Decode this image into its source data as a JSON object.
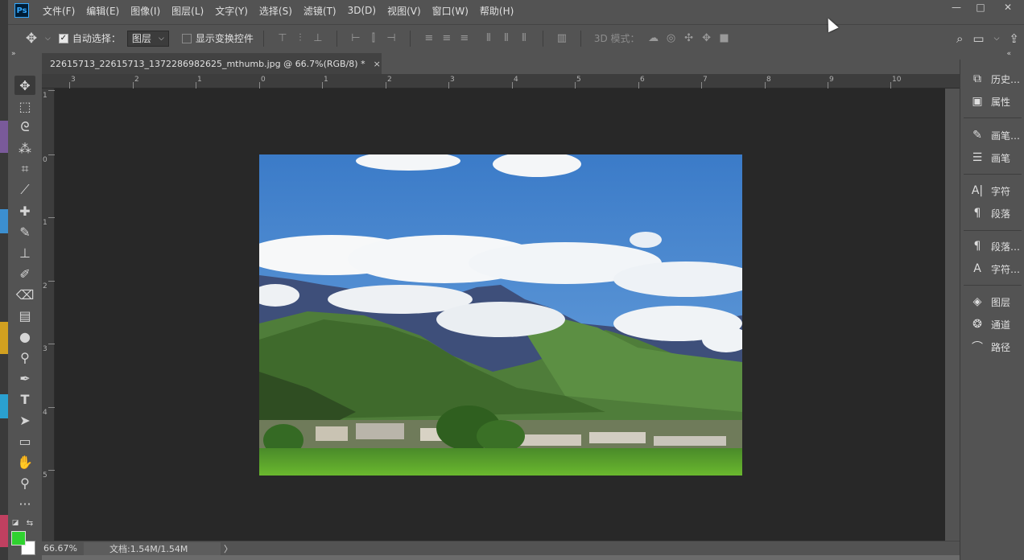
{
  "menubar": {
    "app_logo": "Ps",
    "items": [
      "文件(F)",
      "编辑(E)",
      "图像(I)",
      "图层(L)",
      "文字(Y)",
      "选择(S)",
      "滤镜(T)",
      "3D(D)",
      "视图(V)",
      "窗口(W)",
      "帮助(H)"
    ],
    "window_controls": [
      "—",
      "□",
      "✕"
    ]
  },
  "options": {
    "auto_select_label": "自动选择：",
    "auto_select_checked": true,
    "layer_select_value": "图层",
    "show_transform_label": "显示变换控件",
    "show_transform_checked": false,
    "mode_3d_label": "3D 模式："
  },
  "document": {
    "tab_title": "22615713_22615713_1372286982625_mthumb.jpg @ 66.7%(RGB/8) *",
    "close_glyph": "×"
  },
  "rulers": {
    "top_ticks": [
      "3",
      "2",
      "1",
      "0",
      "1",
      "2",
      "3",
      "4",
      "5",
      "6",
      "7",
      "8",
      "9",
      "10"
    ],
    "left_ticks": [
      "1",
      "0",
      "1",
      "2",
      "3",
      "4",
      "5"
    ]
  },
  "status": {
    "zoom": "66.67%",
    "doc_info": "文档:1.54M/1.54M",
    "arrow": "〉"
  },
  "panels": {
    "groups": [
      [
        "历史…",
        "属性"
      ],
      [
        "画笔…",
        "画笔"
      ],
      [
        "字符",
        "段落"
      ],
      [
        "段落…",
        "字符…"
      ],
      [
        "图层",
        "通道",
        "路径"
      ]
    ]
  },
  "colors": {
    "foreground": "#2fd22f",
    "background": "#ffffff",
    "ui_panel": "#535353",
    "canvas_bg": "#282828"
  },
  "icons": {
    "tools": [
      "move-icon",
      "marquee-icon",
      "lasso-icon",
      "magic-wand-icon",
      "crop-icon",
      "eyedropper-icon",
      "healing-brush-icon",
      "brush-icon",
      "clone-stamp-icon",
      "history-brush-icon",
      "eraser-icon",
      "gradient-icon",
      "blur-icon",
      "dodge-icon",
      "pen-icon",
      "type-icon",
      "path-select-icon",
      "rectangle-icon",
      "hand-icon",
      "zoom-icon",
      "more-tools-icon"
    ]
  }
}
